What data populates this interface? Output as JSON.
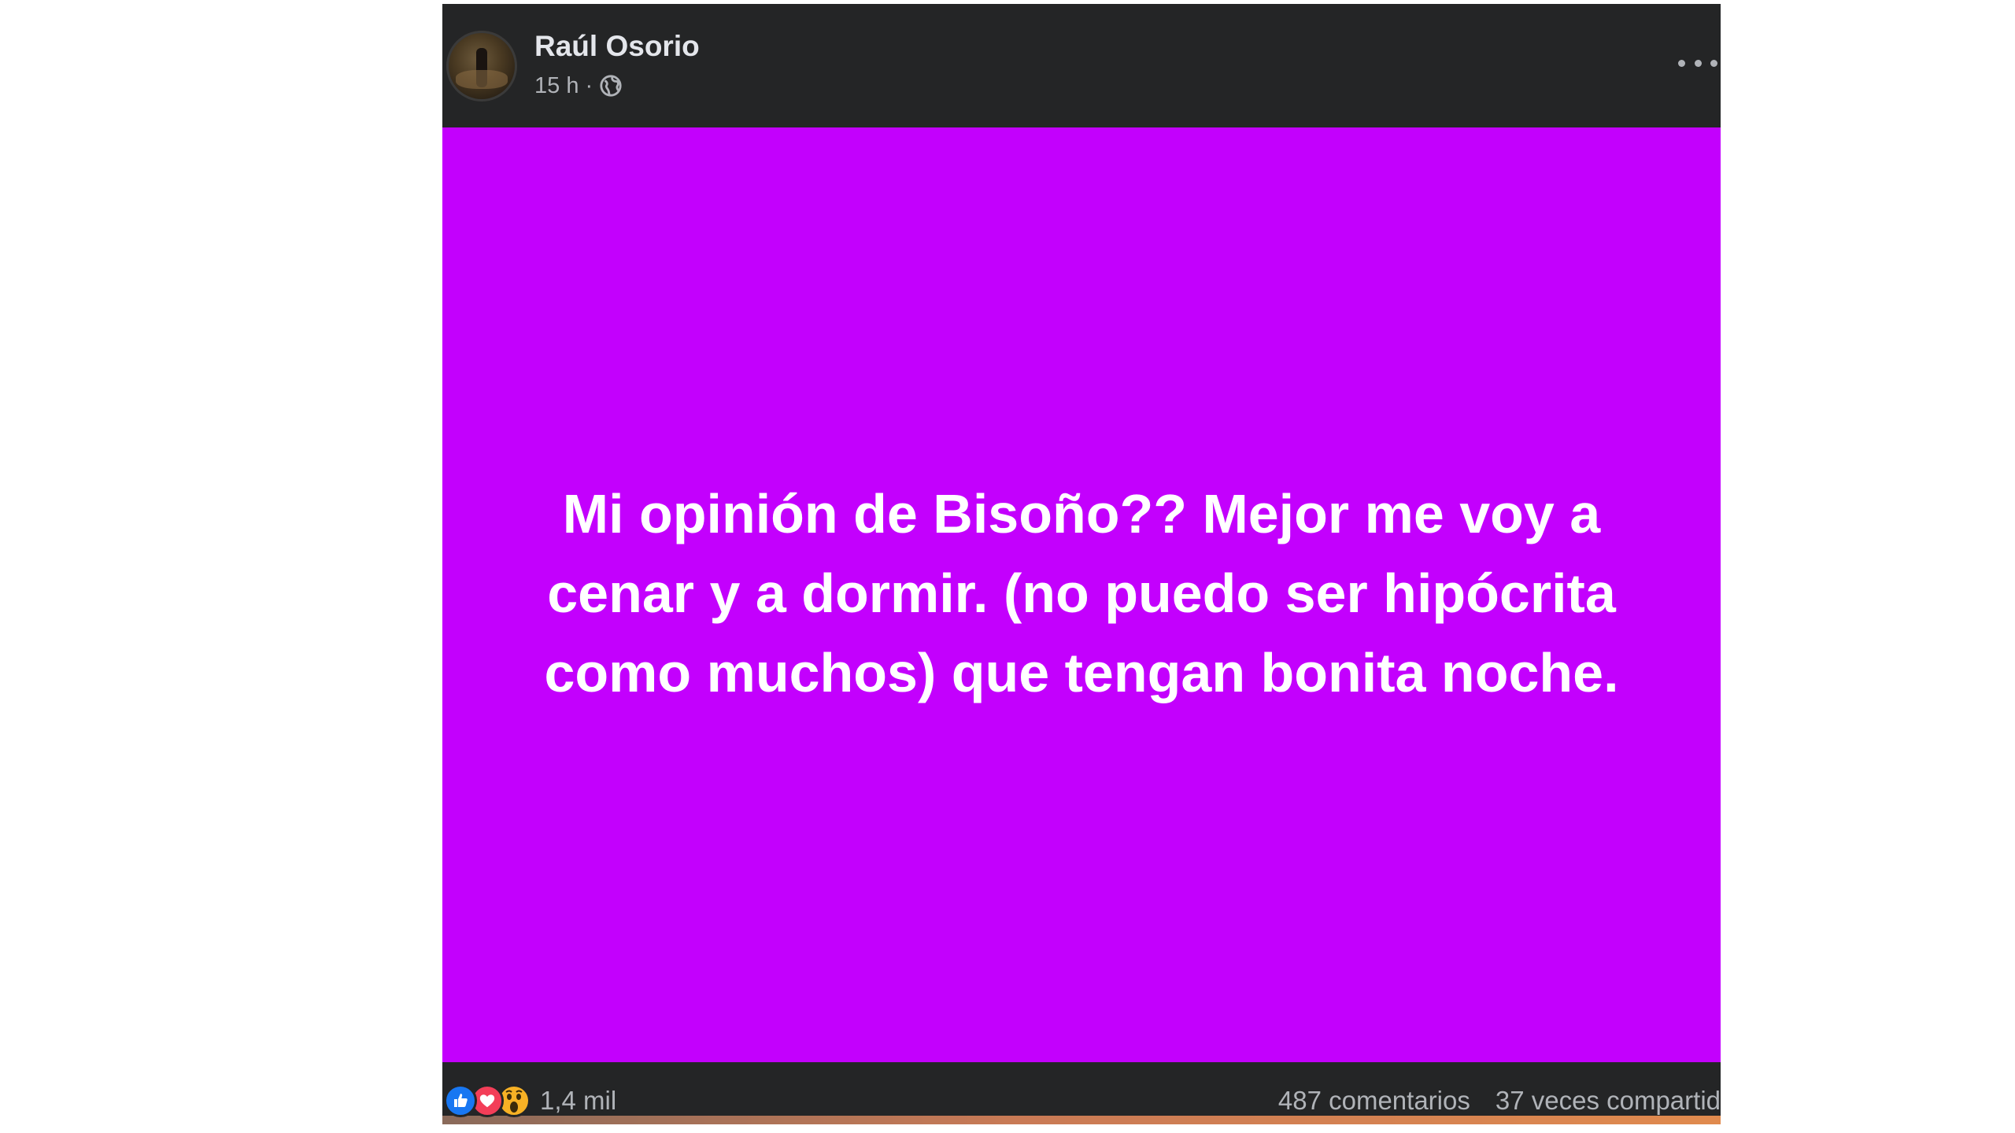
{
  "post": {
    "author": "Raúl Osorio",
    "time": "15 h",
    "separator": "·",
    "privacy_icon": "globe-icon",
    "more_icon": "more-options-icon",
    "background_color": "#c300fd",
    "text": "Mi opinión de Bisoño?? Mejor me voy a cenar y a dormir. (no puedo ser hipócrita como muchos) que tengan bonita noche."
  },
  "footer": {
    "reaction_icons": [
      "like-icon",
      "love-icon",
      "wow-icon"
    ],
    "reaction_count": "1,4 mil",
    "comments": "487 comentarios",
    "shares": "37 veces compartid"
  },
  "colors": {
    "card_background": "#242526",
    "primary_text": "#e4e6eb",
    "secondary_text": "#b0b3b8",
    "like": "#1877f2",
    "love": "#f33e58",
    "wow": "#f7b125"
  }
}
